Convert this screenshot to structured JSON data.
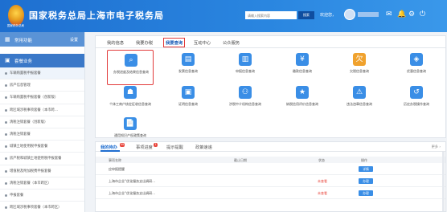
{
  "header": {
    "title": "国家税务总局上海市电子税务局",
    "emblem_caption": "国家税务总局",
    "search": {
      "placeholder": "请输入搜索内容",
      "button": "搜索"
    },
    "welcome": "欢迎您，"
  },
  "sidebar": {
    "section1": {
      "label": "常用功能",
      "action": "设置"
    },
    "section2": {
      "label": "套餐业务"
    },
    "items": [
      "车辆购置税申报套餐",
      "房产信息管理",
      "车辆购置税申报套餐（创新版）",
      "跨区域涉税事项套餐（本市跨…",
      "清税注销套餐（创新版）",
      "清税注销套餐",
      "城镇土地使用税申报套餐",
      "房产税和城镇土地使用税申报套餐",
      "增值税及附加税费申报套餐",
      "清税注销套餐（本市跨区）",
      "申报套餐",
      "跨区域涉税事项套餐（本市跨区）"
    ]
  },
  "main": {
    "tabs": [
      "我的信息",
      "我要办税",
      "我要查询",
      "互动中心",
      "公众服务"
    ],
    "selected_tab": "我要查询",
    "tiles": [
      {
        "label": "办税进度及结果信息查询",
        "icon": "progress-search-icon",
        "color": "#3a8ee6"
      },
      {
        "label": "发票信息查询",
        "icon": "invoice-icon",
        "color": "#3a8ee6"
      },
      {
        "label": "申报信息查询",
        "icon": "declaration-icon",
        "color": "#3a8ee6"
      },
      {
        "label": "缴款信息查询",
        "icon": "payment-icon",
        "color": "#3a8ee6"
      },
      {
        "label": "欠税信息查询",
        "icon": "tax-arrears-icon",
        "color": "#f0a22e"
      },
      {
        "label": "优惠信息查询",
        "icon": "preferential-icon",
        "color": "#3a8ee6"
      },
      {
        "label": "个体工商户核定征收信息查询",
        "icon": "merchant-icon",
        "color": "#3a8ee6"
      },
      {
        "label": "证明信息查询",
        "icon": "certificate-icon",
        "color": "#3a8ee6"
      },
      {
        "label": "涉税中介机构信息查询",
        "icon": "agency-icon",
        "color": "#3a8ee6"
      },
      {
        "label": "纳税信用评价信息查询",
        "icon": "credit-icon",
        "color": "#3a8ee6"
      },
      {
        "label": "违法违章信息查询",
        "icon": "violation-icon",
        "color": "#3a8ee6"
      },
      {
        "label": "历史办税操作查询",
        "icon": "history-icon",
        "color": "#3a8ee6"
      },
      {
        "label": "通用知识产权政策查询",
        "icon": "policy-icon",
        "color": "#3a8ee6"
      }
    ]
  },
  "bottom": {
    "tabs": [
      {
        "label": "我的待办",
        "badge": "99"
      },
      {
        "label": "事项进度",
        "badge": "1"
      },
      {
        "label": "提示提醒",
        "badge": ""
      },
      {
        "label": "政策速递",
        "badge": ""
      }
    ],
    "more": "更多 ›",
    "columns": [
      "事项名称",
      "截止日期",
      "状态",
      "操作"
    ],
    "rows": [
      {
        "name": "应申报提醒",
        "status": "",
        "action": "详情"
      },
      {
        "name": "上海市企业“优化服务支出调研…",
        "status": "未查看",
        "action": "办理"
      },
      {
        "name": "上海市企业“优化服务支出调研…",
        "status": "未查看",
        "action": "办理"
      }
    ]
  }
}
